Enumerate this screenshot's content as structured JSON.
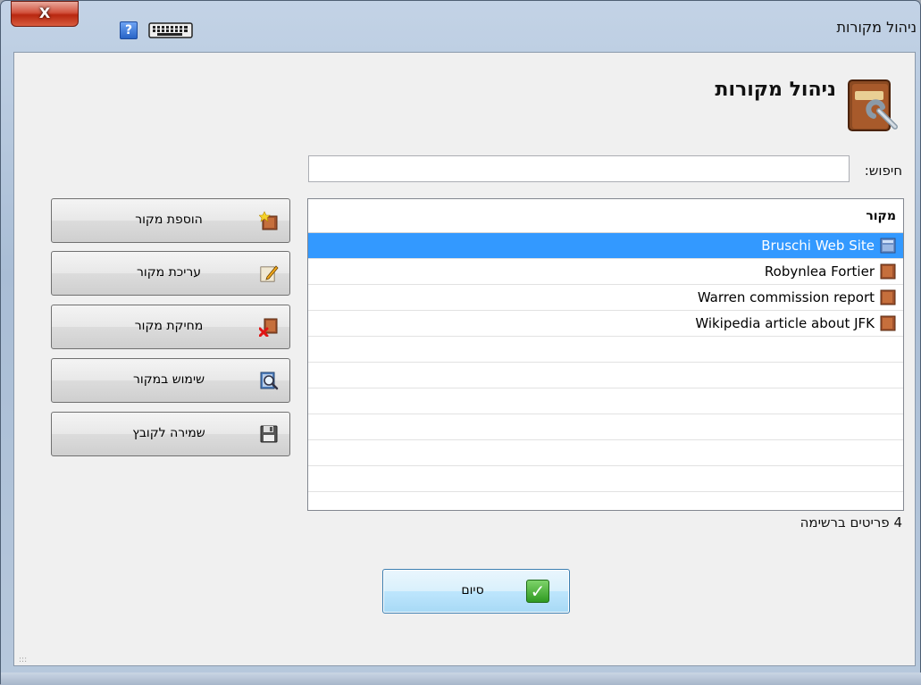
{
  "window": {
    "title": "ניהול מקורות",
    "close_label": "X",
    "help_label": "?"
  },
  "heading": "ניהול מקורות",
  "search": {
    "label": "חיפוש:",
    "value": ""
  },
  "list": {
    "column_header": "מקור",
    "items": [
      {
        "label": "Bruschi Web Site",
        "selected": true,
        "icon": "web-source-icon"
      },
      {
        "label": "Robynlea Fortier",
        "selected": false,
        "icon": "book-icon"
      },
      {
        "label": "Warren commission report",
        "selected": false,
        "icon": "book-icon"
      },
      {
        "label": "Wikipedia article about JFK",
        "selected": false,
        "icon": "book-icon"
      }
    ],
    "count_text": "4 פריטים ברשימה"
  },
  "actions": {
    "add": "הוספת מקור",
    "edit": "עריכת מקור",
    "delete": "מחיקת מקור",
    "usage": "שימוש במקור",
    "save": "שמירה לקובץ"
  },
  "done_label": "סיום",
  "colors": {
    "selection": "#3399ff",
    "close_button": "#c8381f",
    "done_button_border": "#3c7fb1",
    "check_green": "#3aa52b"
  }
}
